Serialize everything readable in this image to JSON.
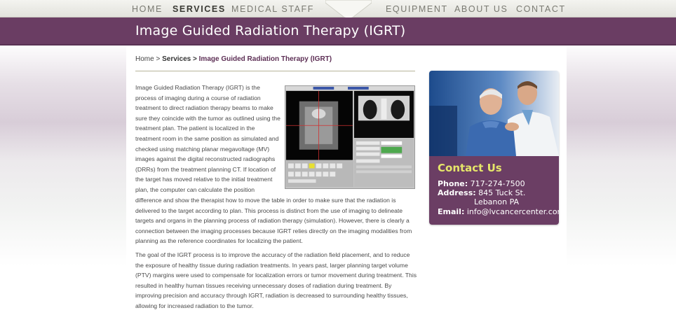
{
  "nav": {
    "items": [
      {
        "label": "HOME"
      },
      {
        "label": "SERVICES"
      },
      {
        "label": "MEDICAL STAFF"
      },
      {
        "label": "EQUIPMENT"
      },
      {
        "label": "ABOUT US"
      },
      {
        "label": "CONTACT"
      }
    ],
    "active": "SERVICES"
  },
  "page": {
    "title": "Image Guided Radiation Therapy (IGRT)"
  },
  "breadcrumb": {
    "home": "Home",
    "sep": ">",
    "services": "Services",
    "current": "Image Guided Radiation Therapy (IGRT)"
  },
  "article": {
    "para1_narrow": "Image Guided Radiation Therapy (IGRT) is the process of imaging during a course of radiation treatment to direct radiation therapy beams to make sure they coincide with the tumor as outlined using the treatment plan. The patient is localized in the treatment room in the same position as simulated and checked using matching planar megavoltage (MV) images against the digital reconstructed radiographs (DRRs) from the treatment planning CT. If location of the target has moved relative to the initial treatment plan, the computer can calculate the position",
    "para1_wide": "difference and show the therapist how to move the table in order to make sure that the radiation is delivered to the target according to plan. This process is distinct from the use of imaging to delineate targets and organs in the planning process of radiation therapy (simulation). However, there is clearly a connection between the imaging processes because IGRT relies directly on the imaging modalities from planning as the reference coordinates for localizing the patient.",
    "para2": "The goal of the IGRT process is to improve the accuracy of the radiation field placement, and to reduce the exposure of healthy tissue during radiation treatments. In years past, larger planning target volume (PTV) margins were used to compensate for localization errors or tumor movement during treatment. This resulted in healthy human tissues receiving unnecessary doses of radiation during treatment. By improving precision and accuracy through IGRT, radiation is decreased to surrounding healthy tissues, allowing for increased radiation to the tumor."
  },
  "contact": {
    "title": "Contact Us",
    "phone_label": "Phone:",
    "phone": "717-274-7500",
    "address_label": "Address:",
    "address_line1": "845 Tuck St.",
    "address_line2": "Lebanon PA",
    "email_label": "Email:",
    "email": "info@lvcancercenter.com"
  },
  "colors": {
    "brand_purple": "#6a3d63",
    "accent_yellow": "#e6e66a"
  }
}
